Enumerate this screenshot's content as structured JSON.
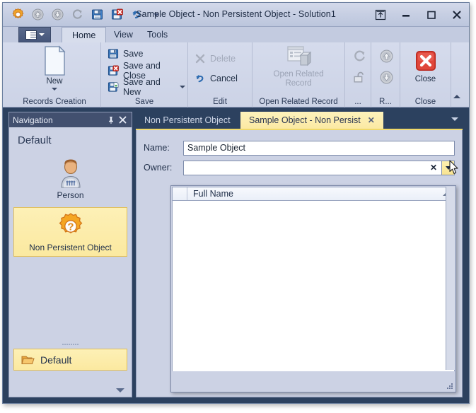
{
  "window": {
    "title": "Sample Object - Non Persistent Object - Solution1",
    "quick_access": [
      {
        "name": "app-gear-icon",
        "label": "Application"
      },
      {
        "name": "previous-icon",
        "label": "Previous"
      },
      {
        "name": "next-icon",
        "label": "Next"
      },
      {
        "name": "refresh-icon",
        "label": "Refresh"
      },
      {
        "name": "save-icon",
        "label": "Save"
      },
      {
        "name": "save-and-close-icon",
        "label": "Save and Close"
      },
      {
        "name": "undo-icon",
        "label": "Undo"
      },
      {
        "name": "customize-qat-icon",
        "label": "Customize Quick Access Toolbar"
      }
    ],
    "buttons": {
      "restore_label": "⤒",
      "minimize_label": "➖",
      "maximize_label": "☐",
      "close_label": "✕"
    }
  },
  "ribbon": {
    "app_menu_label": "Application Menu",
    "tabs": [
      {
        "label": "Home",
        "active": true
      },
      {
        "label": "View",
        "active": false
      },
      {
        "label": "Tools",
        "active": false
      }
    ],
    "groups": [
      {
        "label": "Records Creation",
        "big_button": {
          "label": "New",
          "enabled": true,
          "has_dropdown": true
        }
      },
      {
        "label": "Save",
        "items": [
          {
            "label": "Save",
            "enabled": true,
            "dropdown": false
          },
          {
            "label": "Save and Close",
            "enabled": true,
            "dropdown": false
          },
          {
            "label": "Save and New",
            "enabled": true,
            "dropdown": true
          }
        ]
      },
      {
        "label": "Edit",
        "items": [
          {
            "label": "Delete",
            "enabled": false,
            "dropdown": false
          },
          {
            "label": "Cancel",
            "enabled": true,
            "dropdown": false
          }
        ]
      },
      {
        "label": "Open Related Record",
        "big_button": {
          "label": "Open Related\nRecord",
          "label_line1": "Open Related",
          "label_line2": "Record",
          "enabled": false,
          "has_dropdown": false
        }
      },
      {
        "label": "...",
        "items": [
          {
            "label": "",
            "enabled": false
          },
          {
            "label": "",
            "enabled": false
          }
        ]
      },
      {
        "label": "R...",
        "items": [
          {
            "label": "",
            "enabled": false
          },
          {
            "label": "",
            "enabled": false
          }
        ]
      },
      {
        "label": "Close",
        "big_button": {
          "label": "Close",
          "enabled": true,
          "has_dropdown": false
        }
      }
    ],
    "collapse_label": "Minimize the Ribbon"
  },
  "navigation": {
    "header": {
      "title": "Navigation",
      "pin_label": "Pin",
      "close_label": "Close"
    },
    "group_title": "Default",
    "items": [
      {
        "label": "Person",
        "icon": "person-icon",
        "selected": false
      },
      {
        "label": "Non Persistent Object",
        "icon": "gear-question-icon",
        "selected": true
      }
    ],
    "footer_items": [
      {
        "label": "Default",
        "icon": "folder-icon",
        "selected": true
      }
    ],
    "more_label": "Configure buttons"
  },
  "document": {
    "tabs": [
      {
        "label": "Non Persistent Object",
        "active": false,
        "closable": false
      },
      {
        "label": "Sample Object - Non Persist",
        "active": true,
        "closable": true,
        "close_label": "✕"
      }
    ],
    "tab_menu_label": "Window list",
    "fields": [
      {
        "label": "Name:",
        "value": "Sample Object",
        "type": "text",
        "placeholder": ""
      },
      {
        "label": "Owner:",
        "value": "",
        "type": "lookup",
        "placeholder": "",
        "clear_label": "✕",
        "dropdown_label": "Open dropdown"
      }
    ],
    "dropdown": {
      "open": true,
      "columns": [
        "Full Name"
      ],
      "rows": [],
      "sort": "ascending",
      "resize_label": "Resize"
    }
  },
  "colors": {
    "window_frame": "#2c415f",
    "ribbon_bg": "#d0d7e8",
    "accent_yellow": "#fbe9a0",
    "tab_border_yellow": "#f0d96a",
    "nav_header": "#42506f",
    "close_red": "#c8342c"
  }
}
